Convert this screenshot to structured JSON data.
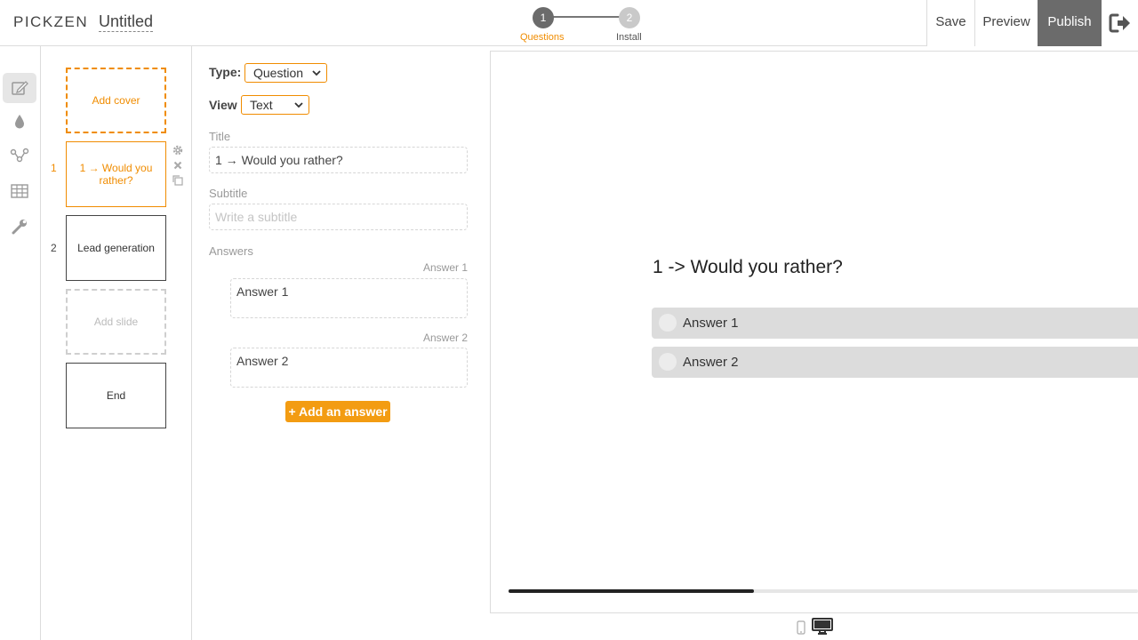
{
  "header": {
    "logo": "PICKZEN",
    "doc_title": "Untitled",
    "steps": [
      {
        "number": "1",
        "label": "Questions"
      },
      {
        "number": "2",
        "label": "Install"
      }
    ],
    "save_label": "Save",
    "preview_label": "Preview",
    "publish_label": "Publish"
  },
  "rail": {
    "icons": [
      "edit-icon",
      "drop-icon",
      "flow-icon",
      "table-icon",
      "wrench-icon"
    ]
  },
  "slides": {
    "cover": "Add cover",
    "items": [
      {
        "number": "1",
        "label": "1 → Would you rather?"
      },
      {
        "number": "2",
        "label": "Lead generation"
      }
    ],
    "add_slide": "Add slide",
    "end": "End"
  },
  "editor": {
    "type_label": "Type:",
    "type_value": "Question",
    "view_label": "View",
    "view_value": "Text",
    "title_label": "Title",
    "title_value": "1 → Would you rather?",
    "subtitle_label": "Subtitle",
    "subtitle_placeholder": "Write a subtitle",
    "answers_label": "Answers",
    "answers": [
      {
        "label": "Answer 1",
        "value": "Answer 1"
      },
      {
        "label": "Answer 2",
        "value": "Answer 2"
      }
    ],
    "add_answer_label": "+ Add an answer"
  },
  "preview": {
    "title": "1 -> Would you rather?",
    "answers": [
      "Answer 1",
      "Answer 2"
    ],
    "progress": 0.39
  },
  "colors": {
    "accent": "#f08c00",
    "button_orange": "#f39c12",
    "publish_bg": "#6b6b6b"
  }
}
